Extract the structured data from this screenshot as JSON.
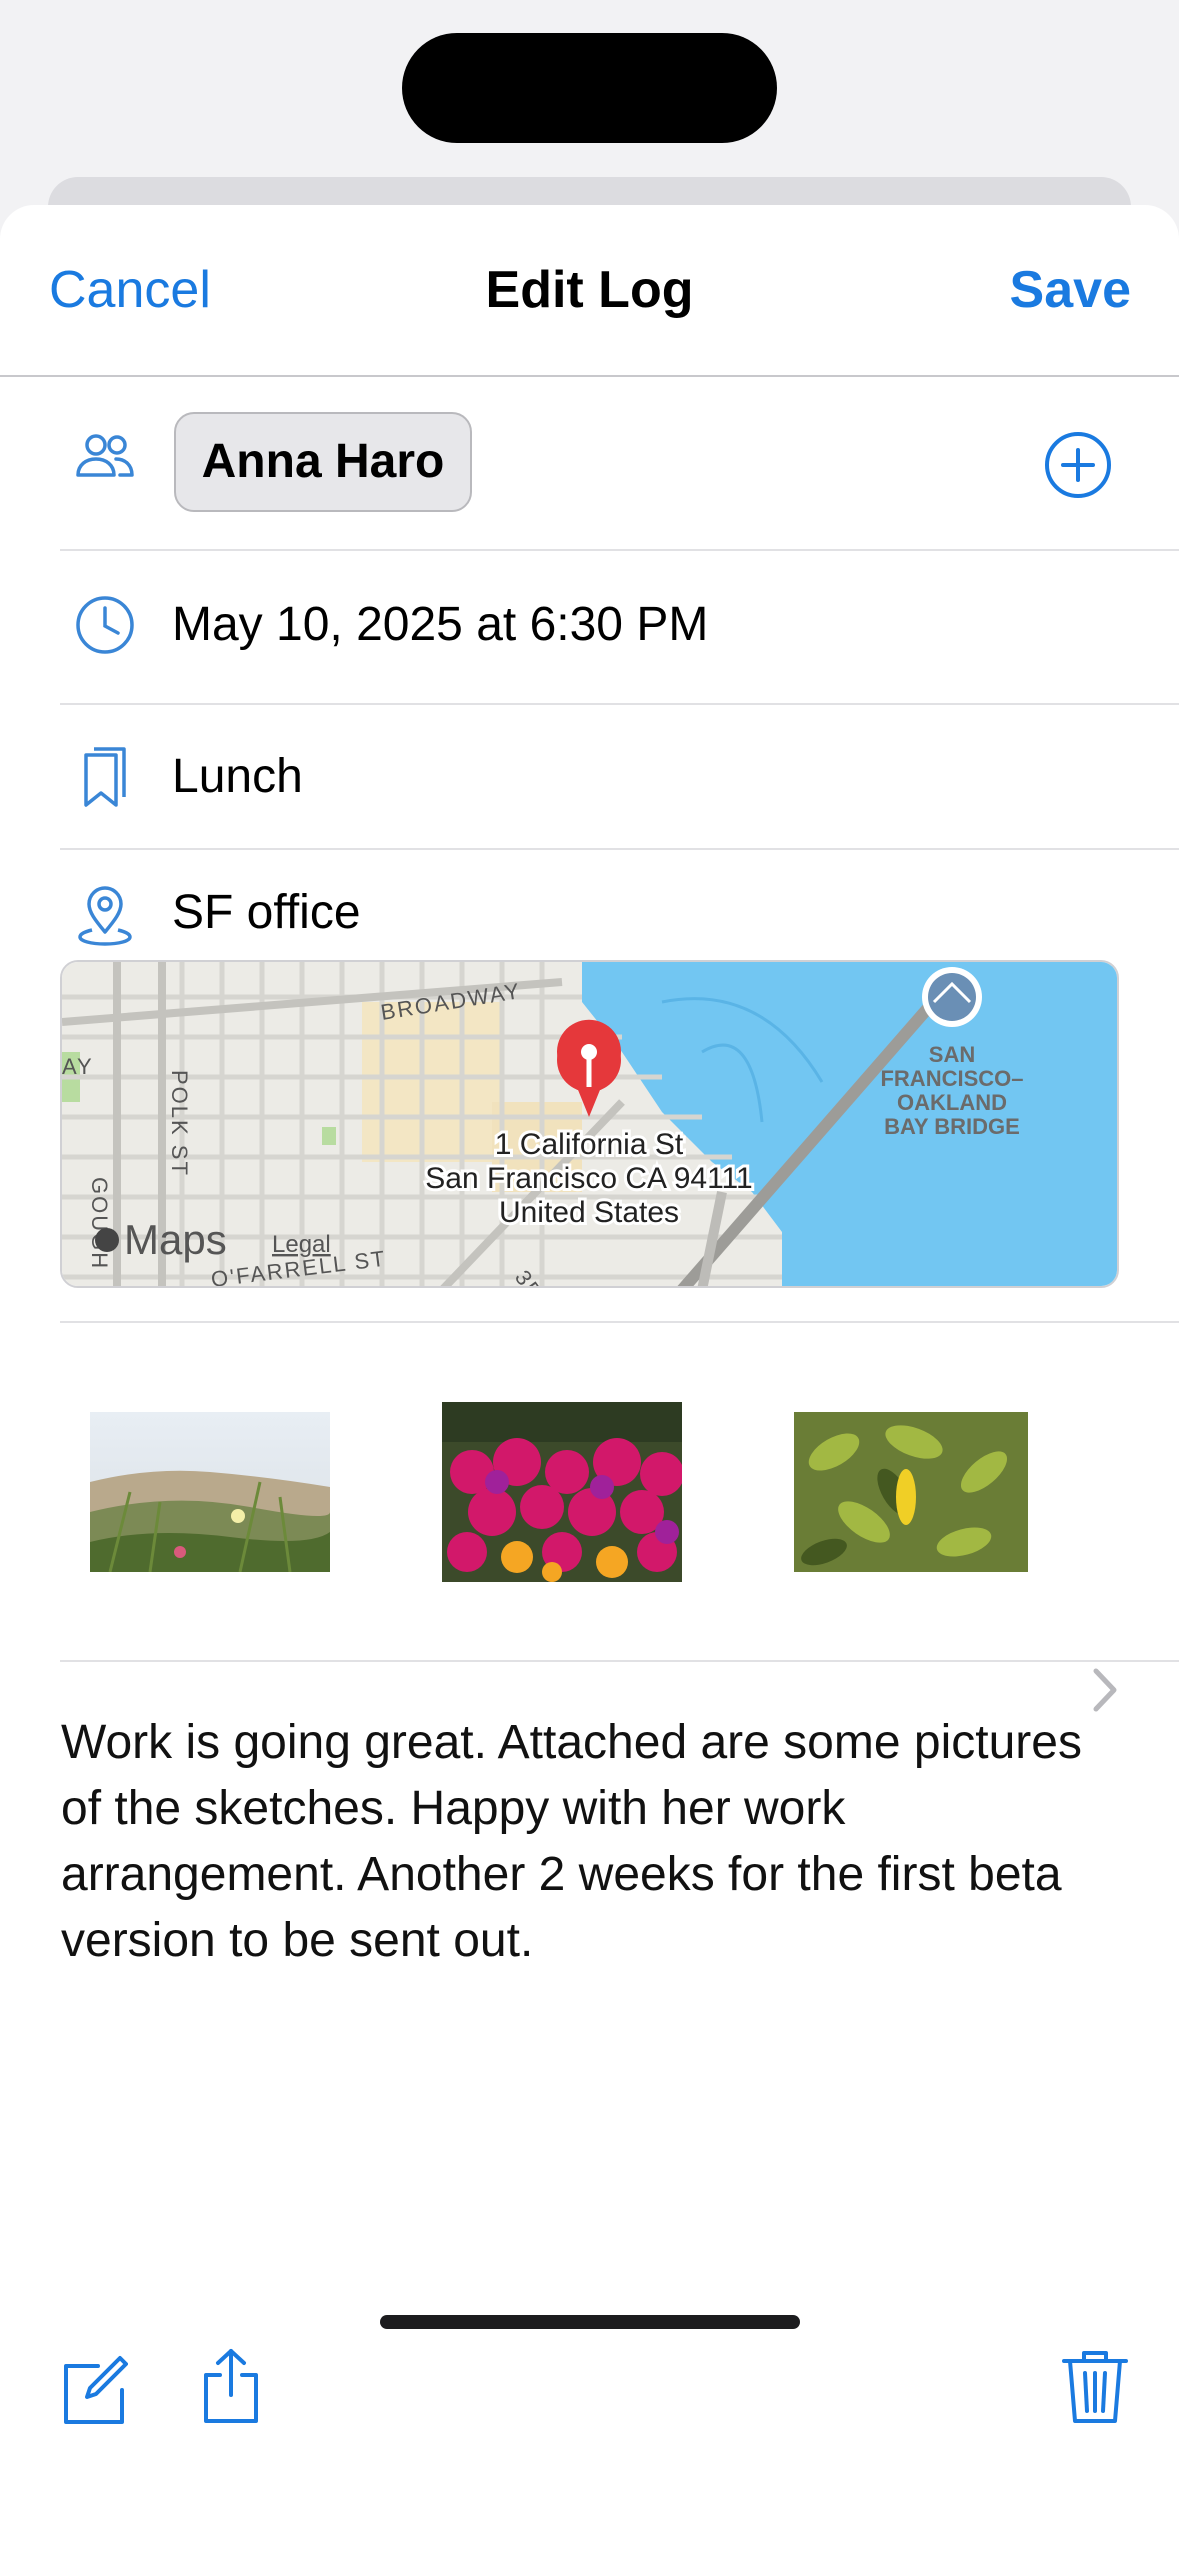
{
  "nav": {
    "cancel_label": "Cancel",
    "title": "Edit Log",
    "save_label": "Save"
  },
  "contact": {
    "icon": "people-icon",
    "name": "Anna Haro",
    "add_icon": "plus-circle-icon"
  },
  "datetime": {
    "icon": "clock-icon",
    "value": "May 10, 2025 at 6:30 PM"
  },
  "category": {
    "icon": "bookmark-icon",
    "value": "Lunch"
  },
  "location": {
    "icon": "location-pin-icon",
    "name": "SF office",
    "map": {
      "address_line1": "1 California St",
      "address_line2": "San Francisco CA 94111",
      "address_line3": "United States",
      "street_broadway": "BROADWAY",
      "street_polk": "POLK ST",
      "street_gough": "GOUGH",
      "street_ofarrell": "O'FARRELL ST",
      "street_3rd": "3R",
      "street_ay": "AY",
      "landmark_line1": "SAN",
      "landmark_line2": "FRANCISCO–",
      "landmark_line3": "OAKLAND",
      "landmark_line4": "BAY BRIDGE",
      "maps_label": "Maps",
      "legal_label": "Legal"
    }
  },
  "photos": [
    {
      "name": "photo-dunes"
    },
    {
      "name": "photo-flowers"
    },
    {
      "name": "photo-leaves"
    }
  ],
  "note": "Work is going great. Attached are some pictures of the sketches. Happy with her work arrangement. Another 2 weeks for the first beta version to be sent out.",
  "toolbar": {
    "compose_icon": "compose-icon",
    "share_icon": "share-icon",
    "delete_icon": "trash-icon"
  },
  "colors": {
    "accent": "#1a7ae0",
    "pin": "#e5383b",
    "water": "#72c6f2"
  }
}
